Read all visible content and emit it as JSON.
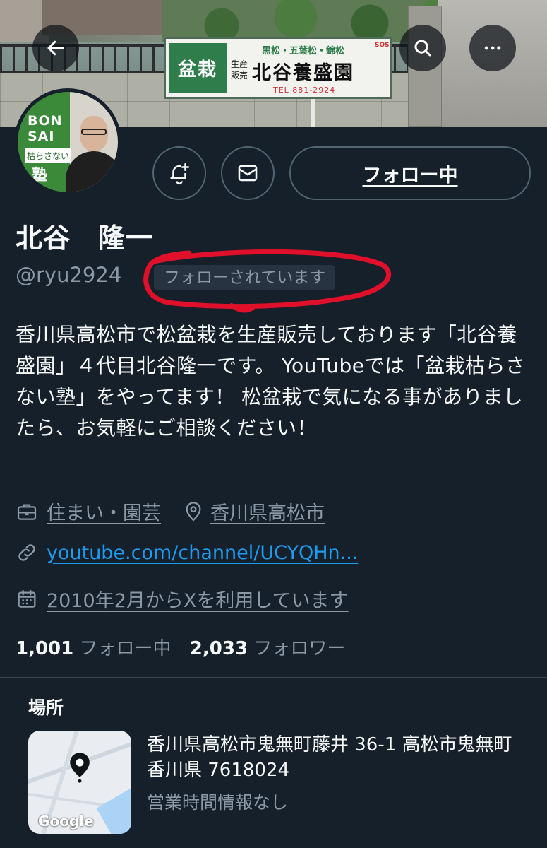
{
  "banner": {
    "sign": {
      "main": "盆栽",
      "sub": "黒松・五葉松・錦松",
      "small": "生産販売",
      "name": "北谷養盛園",
      "tel": "TEL 881-2924",
      "badge": "SOS"
    }
  },
  "avatar": {
    "brand_top": "BON SAI",
    "brand_mid": "枯らさない",
    "brand_bot": "塾"
  },
  "actions": {
    "follow_label": "フォロー中"
  },
  "profile": {
    "name": "北谷　隆一",
    "handle": "@ryu2924",
    "follows_you": "フォローされています",
    "bio": "香川県高松市で松盆栽を生産販売しております「北谷養盛園」４代目北谷隆一です。 YouTubeでは「盆栽枯らさない塾」をやってます！ 松盆栽で気になる事がありましたら、お気軽にご相談ください！"
  },
  "meta": {
    "category": "住まい・園芸",
    "location": "香川県高松市",
    "url": "youtube.com/channel/UCYQHn...",
    "joined": "2010年2月からXを利用しています"
  },
  "stats": {
    "following_count": "1,001",
    "following_label": "フォロー中",
    "followers_count": "2,033",
    "followers_label": "フォロワー"
  },
  "location_card": {
    "title": "場所",
    "address": "香川県高松市鬼無町藤井 36-1 高松市鬼無町 香川県 7618024",
    "hours": "営業時間情報なし",
    "map_brand": "Google"
  },
  "colors": {
    "background": "#15202b",
    "link": "#1d9bf0",
    "secondary_text": "#8b98a5",
    "annotation": "#e0102a"
  },
  "icons": {
    "back": "arrow-left-icon",
    "search": "search-icon",
    "more": "more-horizontal-icon",
    "notify": "bell-plus-icon",
    "message": "envelope-icon",
    "category": "briefcase-icon",
    "location": "map-pin-icon",
    "url": "link-icon",
    "joined": "calendar-icon"
  }
}
